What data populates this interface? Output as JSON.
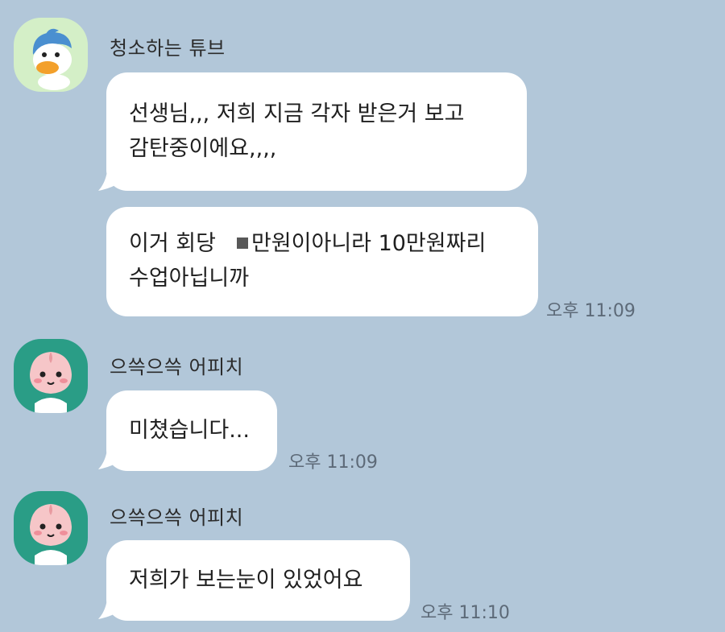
{
  "messages": [
    {
      "sender": "청소하는 튜브",
      "avatar": "duck-avatar",
      "bubbles": [
        {
          "lines": [
            "선생님,,, 저희 지금 각자 받은거 보고",
            "감탄중이에요,,,,"
          ]
        },
        {
          "line1_prefix": "이거 회당",
          "line1_suffix": "만원이아니라 10만원짜리",
          "line2": "수업아닙니까"
        }
      ],
      "time": "오후 11:09"
    },
    {
      "sender": "으쓱으쓱 어피치",
      "avatar": "peach-avatar",
      "bubbles": [
        {
          "text": "미쳤습니다..."
        }
      ],
      "time": "오후 11:09"
    },
    {
      "sender": "으쓱으쓱 어피치",
      "avatar": "peach-avatar",
      "bubbles": [
        {
          "text": "저희가 보는눈이 있었어요"
        }
      ],
      "time": "오후 11:10"
    }
  ],
  "colors": {
    "background": "#b2c7d9",
    "bubble": "#ffffff",
    "duck_avatar_bg": "#d4efc7",
    "peach_avatar_bg": "#2a9d86"
  }
}
